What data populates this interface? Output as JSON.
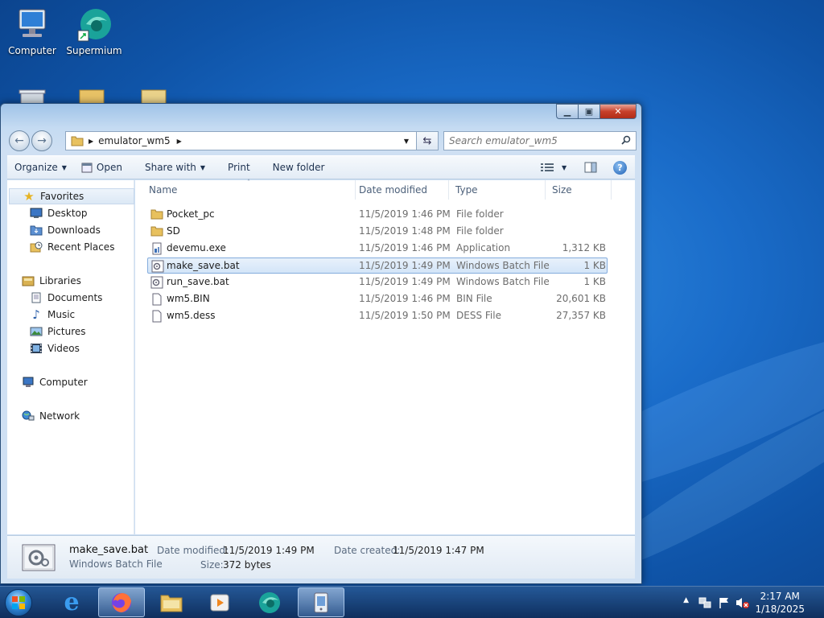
{
  "desktop": {
    "icons": [
      {
        "label": "Computer"
      },
      {
        "label": "Supermium"
      }
    ]
  },
  "window": {
    "address": {
      "segments": [
        "emulator_wm5"
      ],
      "search_placeholder": "Search emulator_wm5"
    },
    "toolbar": {
      "organize": "Organize",
      "open": "Open",
      "share_with": "Share with",
      "print": "Print",
      "new_folder": "New folder"
    },
    "nav": {
      "favorites": "Favorites",
      "desktop": "Desktop",
      "downloads": "Downloads",
      "recent_places": "Recent Places",
      "libraries": "Libraries",
      "documents": "Documents",
      "music": "Music",
      "pictures": "Pictures",
      "videos": "Videos",
      "computer": "Computer",
      "network": "Network"
    },
    "columns": {
      "name": "Name",
      "date_modified": "Date modified",
      "type": "Type",
      "size": "Size"
    },
    "files": [
      {
        "name": "Pocket_pc",
        "date": "11/5/2019 1:46 PM",
        "type": "File folder",
        "size": ""
      },
      {
        "name": "SD",
        "date": "11/5/2019 1:48 PM",
        "type": "File folder",
        "size": ""
      },
      {
        "name": "devemu.exe",
        "date": "11/5/2019 1:46 PM",
        "type": "Application",
        "size": "1,312 KB"
      },
      {
        "name": "make_save.bat",
        "date": "11/5/2019 1:49 PM",
        "type": "Windows Batch File",
        "size": "1 KB"
      },
      {
        "name": "run_save.bat",
        "date": "11/5/2019 1:49 PM",
        "type": "Windows Batch File",
        "size": "1 KB"
      },
      {
        "name": "wm5.BIN",
        "date": "11/5/2019 1:46 PM",
        "type": "BIN File",
        "size": "20,601 KB"
      },
      {
        "name": "wm5.dess",
        "date": "11/5/2019 1:50 PM",
        "type": "DESS File",
        "size": "27,357 KB"
      }
    ],
    "details": {
      "name": "make_save.bat",
      "type": "Windows Batch File",
      "date_modified_label": "Date modified:",
      "date_modified": "11/5/2019 1:49 PM",
      "date_created_label": "Date created:",
      "date_created": "11/5/2019 1:47 PM",
      "size_label": "Size:",
      "size": "372 bytes"
    }
  },
  "taskbar": {
    "time": "2:17 AM",
    "date": "1/18/2025"
  }
}
